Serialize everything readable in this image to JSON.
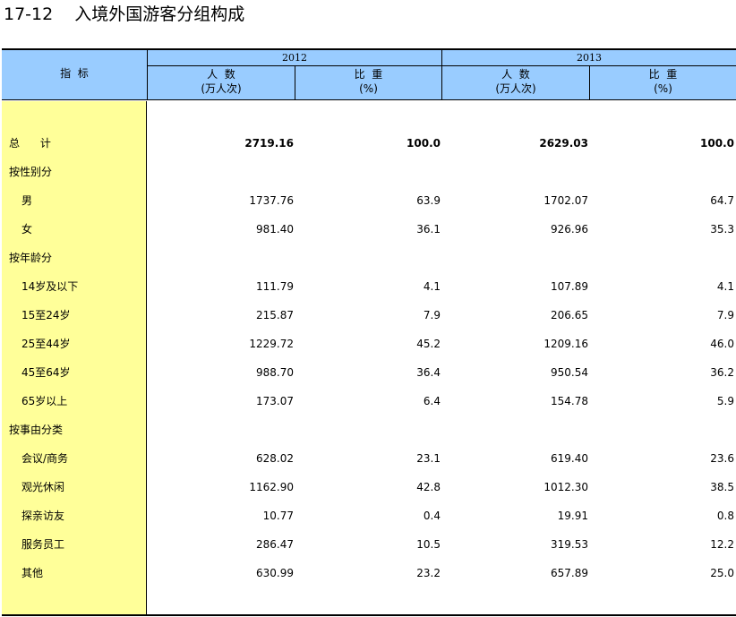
{
  "title": {
    "number": "17-12",
    "text": "入境外国游客分组构成"
  },
  "header": {
    "indicator": "指  标",
    "years": [
      "2012",
      "2013"
    ],
    "persons_l1": "人  数",
    "persons_l2": "(万人次)",
    "share_l1": "比  重",
    "share_l2": "(%)"
  },
  "rows": [
    {
      "label": "总      计",
      "indent": 0,
      "bold": true,
      "v": [
        "2719.16",
        "100.0",
        "2629.03",
        "100.0"
      ]
    },
    {
      "label": "按性别分",
      "indent": 0,
      "bold": false,
      "v": [
        "",
        "",
        "",
        ""
      ]
    },
    {
      "label": "男",
      "indent": 1,
      "bold": false,
      "v": [
        "1737.76",
        "63.9",
        "1702.07",
        "64.7"
      ]
    },
    {
      "label": "女",
      "indent": 1,
      "bold": false,
      "v": [
        "981.40",
        "36.1",
        "926.96",
        "35.3"
      ]
    },
    {
      "label": "按年龄分",
      "indent": 0,
      "bold": false,
      "v": [
        "",
        "",
        "",
        ""
      ]
    },
    {
      "label": "14岁及以下",
      "indent": 1,
      "bold": false,
      "v": [
        "111.79",
        "4.1",
        "107.89",
        "4.1"
      ]
    },
    {
      "label": "15至24岁",
      "indent": 1,
      "bold": false,
      "v": [
        "215.87",
        "7.9",
        "206.65",
        "7.9"
      ]
    },
    {
      "label": "25至44岁",
      "indent": 1,
      "bold": false,
      "v": [
        "1229.72",
        "45.2",
        "1209.16",
        "46.0"
      ]
    },
    {
      "label": "45至64岁",
      "indent": 1,
      "bold": false,
      "v": [
        "988.70",
        "36.4",
        "950.54",
        "36.2"
      ]
    },
    {
      "label": "65岁以上",
      "indent": 1,
      "bold": false,
      "v": [
        "173.07",
        "6.4",
        "154.78",
        "5.9"
      ]
    },
    {
      "label": "按事由分类",
      "indent": 0,
      "bold": false,
      "v": [
        "",
        "",
        "",
        ""
      ]
    },
    {
      "label": "会议/商务",
      "indent": 1,
      "bold": false,
      "v": [
        "628.02",
        "23.1",
        "619.40",
        "23.6"
      ]
    },
    {
      "label": "观光休闲",
      "indent": 1,
      "bold": false,
      "v": [
        "1162.90",
        "42.8",
        "1012.30",
        "38.5"
      ]
    },
    {
      "label": "探亲访友",
      "indent": 1,
      "bold": false,
      "v": [
        "10.77",
        "0.4",
        "19.91",
        "0.8"
      ]
    },
    {
      "label": "服务员工",
      "indent": 1,
      "bold": false,
      "v": [
        "286.47",
        "10.5",
        "319.53",
        "12.2"
      ]
    },
    {
      "label": "其他",
      "indent": 1,
      "bold": false,
      "v": [
        "630.99",
        "23.2",
        "657.89",
        "25.0"
      ]
    }
  ]
}
